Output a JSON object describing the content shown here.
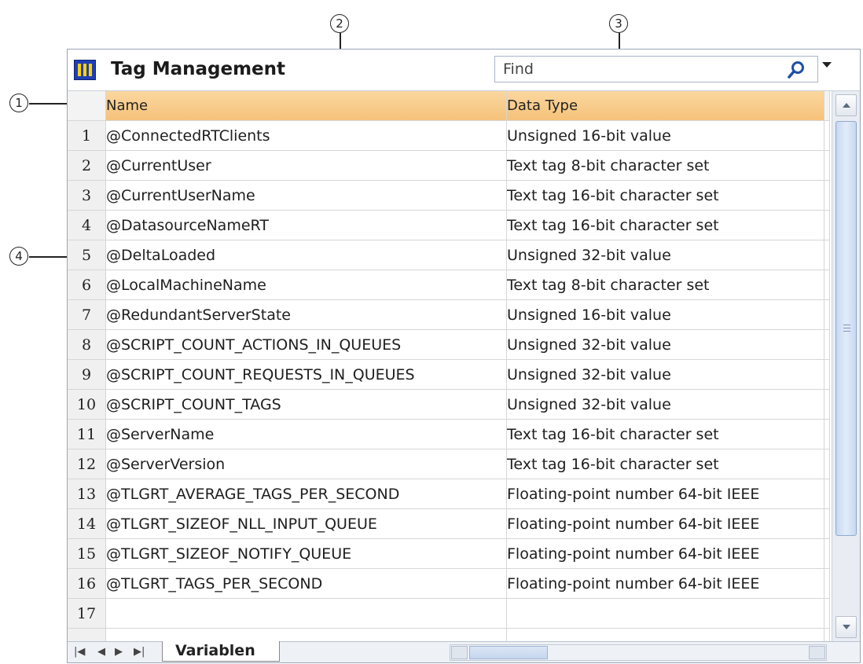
{
  "callouts": [
    "1",
    "2",
    "3",
    "4"
  ],
  "window": {
    "title": "Tag Management",
    "icon": "tag-management-icon",
    "find_placeholder": "Find"
  },
  "columns": {
    "name": "Name",
    "type": "Data Type"
  },
  "rows": [
    {
      "num": "1",
      "name": "@ConnectedRTClients",
      "type": "Unsigned 16-bit value"
    },
    {
      "num": "2",
      "name": "@CurrentUser",
      "type": "Text tag 8-bit character set"
    },
    {
      "num": "3",
      "name": "@CurrentUserName",
      "type": "Text tag 16-bit character set"
    },
    {
      "num": "4",
      "name": "@DatasourceNameRT",
      "type": "Text tag 16-bit character set"
    },
    {
      "num": "5",
      "name": "@DeltaLoaded",
      "type": "Unsigned 32-bit value"
    },
    {
      "num": "6",
      "name": "@LocalMachineName",
      "type": "Text tag 8-bit character set"
    },
    {
      "num": "7",
      "name": "@RedundantServerState",
      "type": "Unsigned 16-bit value"
    },
    {
      "num": "8",
      "name": "@SCRIPT_COUNT_ACTIONS_IN_QUEUES",
      "type": "Unsigned 32-bit value"
    },
    {
      "num": "9",
      "name": "@SCRIPT_COUNT_REQUESTS_IN_QUEUES",
      "type": "Unsigned 32-bit value"
    },
    {
      "num": "10",
      "name": "@SCRIPT_COUNT_TAGS",
      "type": "Unsigned 32-bit value"
    },
    {
      "num": "11",
      "name": "@ServerName",
      "type": "Text tag 16-bit character set"
    },
    {
      "num": "12",
      "name": "@ServerVersion",
      "type": "Text tag 16-bit character set"
    },
    {
      "num": "13",
      "name": "@TLGRT_AVERAGE_TAGS_PER_SECOND",
      "type": "Floating-point number 64-bit IEEE"
    },
    {
      "num": "14",
      "name": "@TLGRT_SIZEOF_NLL_INPUT_QUEUE",
      "type": "Floating-point number 64-bit IEEE"
    },
    {
      "num": "15",
      "name": "@TLGRT_SIZEOF_NOTIFY_QUEUE",
      "type": "Floating-point number 64-bit IEEE"
    },
    {
      "num": "16",
      "name": "@TLGRT_TAGS_PER_SECOND",
      "type": "Floating-point number 64-bit IEEE"
    },
    {
      "num": "17",
      "name": "",
      "type": ""
    },
    {
      "num": "",
      "name": "",
      "type": ""
    }
  ],
  "bottom": {
    "sheet_tab": "Variablen"
  }
}
